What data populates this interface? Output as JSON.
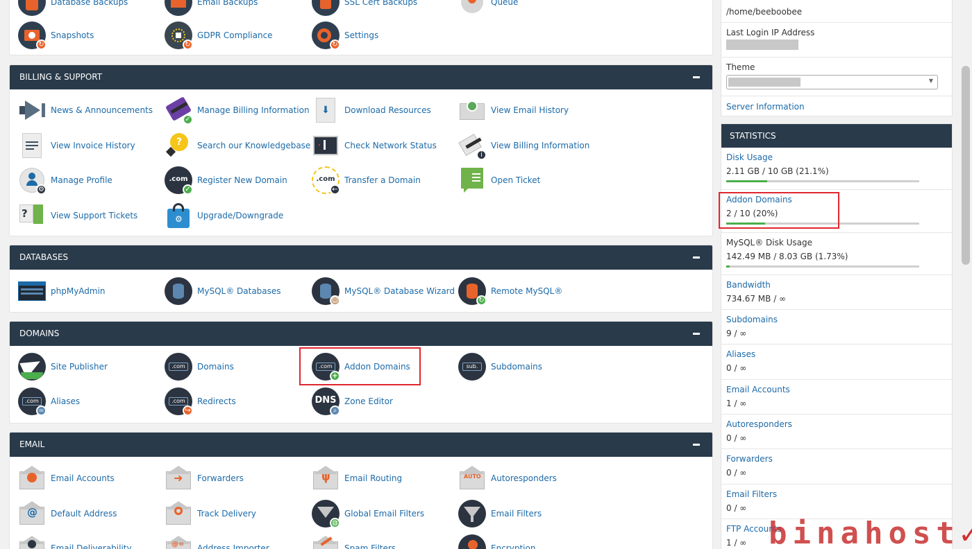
{
  "top_items": [
    {
      "label": "Database Backups"
    },
    {
      "label": "Email Backups"
    },
    {
      "label": "SSL Cert Backups"
    },
    {
      "label": "Queue"
    },
    {
      "label": "Snapshots",
      "icon": "snapshot-icon"
    },
    {
      "label": "GDPR Compliance",
      "icon": "gdpr-icon"
    },
    {
      "label": "Settings",
      "icon": "settings-gear-icon"
    }
  ],
  "sections": {
    "billing": {
      "title": "BILLING & SUPPORT",
      "items": [
        {
          "label": "News & Announcements",
          "icon": "megaphone-icon"
        },
        {
          "label": "Manage Billing Information",
          "icon": "credit-card-icon"
        },
        {
          "label": "Download Resources",
          "icon": "download-icon"
        },
        {
          "label": "View Email History",
          "icon": "email-history-icon"
        },
        {
          "label": "View Invoice History",
          "icon": "invoice-icon"
        },
        {
          "label": "Search our Knowledgebase",
          "icon": "lightbulb-icon"
        },
        {
          "label": "Check Network Status",
          "icon": "network-status-icon"
        },
        {
          "label": "View Billing Information",
          "icon": "billing-info-icon"
        },
        {
          "label": "Manage Profile",
          "icon": "profile-icon"
        },
        {
          "label": "Register New Domain",
          "icon": "register-domain-icon"
        },
        {
          "label": "Transfer a Domain",
          "icon": "transfer-domain-icon"
        },
        {
          "label": "Open Ticket",
          "icon": "ticket-icon"
        },
        {
          "label": "View Support Tickets",
          "icon": "support-tickets-icon"
        },
        {
          "label": "Upgrade/Downgrade",
          "icon": "shopping-bag-icon"
        }
      ]
    },
    "databases": {
      "title": "DATABASES",
      "items": [
        {
          "label": "phpMyAdmin",
          "icon": "phpmyadmin-icon"
        },
        {
          "label": "MySQL® Databases",
          "icon": "database-icon"
        },
        {
          "label": "MySQL® Database Wizard",
          "icon": "database-wizard-icon"
        },
        {
          "label": "Remote MySQL®",
          "icon": "remote-database-icon"
        }
      ]
    },
    "domains": {
      "title": "DOMAINS",
      "items": [
        {
          "label": "Site Publisher",
          "icon": "paper-plane-icon"
        },
        {
          "label": "Domains",
          "icon": "domains-icon"
        },
        {
          "label": "Addon Domains",
          "icon": "addon-domains-icon"
        },
        {
          "label": "Subdomains",
          "icon": "subdomains-icon"
        },
        {
          "label": "Aliases",
          "icon": "aliases-icon"
        },
        {
          "label": "Redirects",
          "icon": "redirects-icon"
        },
        {
          "label": "Zone Editor",
          "icon": "dns-zone-icon"
        }
      ]
    },
    "email": {
      "title": "EMAIL",
      "items": [
        {
          "label": "Email Accounts",
          "icon": "email-accounts-icon"
        },
        {
          "label": "Forwarders",
          "icon": "forwarders-icon"
        },
        {
          "label": "Email Routing",
          "icon": "email-routing-icon"
        },
        {
          "label": "Autoresponders",
          "icon": "autoresponders-icon"
        },
        {
          "label": "Default Address",
          "icon": "default-address-icon"
        },
        {
          "label": "Track Delivery",
          "icon": "track-delivery-icon"
        },
        {
          "label": "Global Email Filters",
          "icon": "global-filter-icon"
        },
        {
          "label": "Email Filters",
          "icon": "email-filter-icon"
        },
        {
          "label": "Email Deliverability",
          "icon": "deliverability-icon"
        },
        {
          "label": "Address Importer",
          "icon": "address-importer-icon"
        },
        {
          "label": "Spam Filters",
          "icon": "spam-filters-icon"
        },
        {
          "label": "Encryption",
          "icon": "encryption-icon"
        }
      ]
    }
  },
  "general_info": {
    "home_directory_value": "/home/beeboobee",
    "last_login_label": "Last Login IP Address",
    "theme_label": "Theme",
    "server_info_link": "Server Information"
  },
  "statistics": {
    "title": "STATISTICS",
    "rows": [
      {
        "label": "Disk Usage",
        "value": "2.11 GB / 10 GB   (21.1%)",
        "usage_fraction": 0.211
      },
      {
        "label": "Addon Domains",
        "value": "2 / 10   (20%)",
        "usage_fraction": 0.2
      },
      {
        "label": "MySQL® Disk Usage",
        "value": "142.49 MB / 8.03 GB   (1.73%)",
        "usage_fraction": 0.0173
      },
      {
        "label": "Bandwidth",
        "value": "734.67 MB / ∞"
      },
      {
        "label": "Subdomains",
        "value": "9 / ∞"
      },
      {
        "label": "Aliases",
        "value": "0 / ∞"
      },
      {
        "label": "Email Accounts",
        "value": "1 / ∞"
      },
      {
        "label": "Autoresponders",
        "value": "0 / ∞"
      },
      {
        "label": "Forwarders",
        "value": "0 / ∞"
      },
      {
        "label": "Email Filters",
        "value": "0 / ∞"
      },
      {
        "label": "FTP Accounts",
        "value": "1 / ∞"
      }
    ]
  },
  "watermark": "binahost",
  "colors": {
    "header": "#293a4a",
    "link": "#1c6aa8",
    "progress": "#4cae4c",
    "highlight": "#e0262e"
  }
}
